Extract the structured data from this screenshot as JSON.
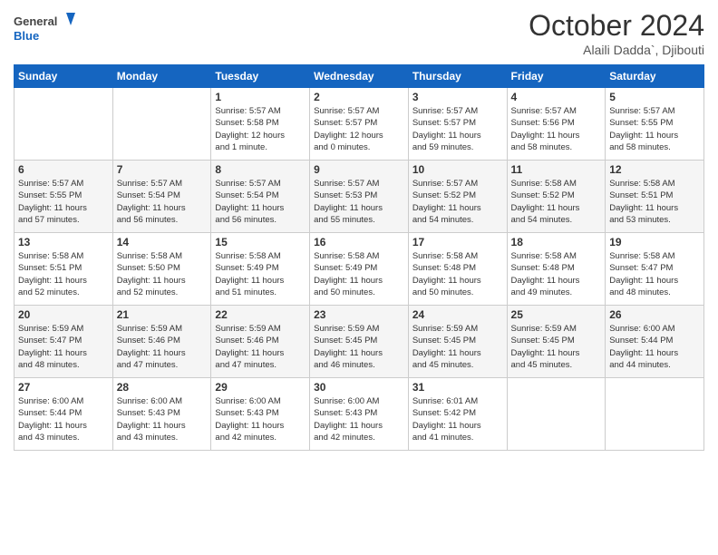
{
  "header": {
    "logo_line1": "General",
    "logo_line2": "Blue",
    "month": "October 2024",
    "location": "Alaili Dadda`, Djibouti"
  },
  "weekdays": [
    "Sunday",
    "Monday",
    "Tuesday",
    "Wednesday",
    "Thursday",
    "Friday",
    "Saturday"
  ],
  "weeks": [
    [
      {
        "day": "",
        "info": ""
      },
      {
        "day": "",
        "info": ""
      },
      {
        "day": "1",
        "info": "Sunrise: 5:57 AM\nSunset: 5:58 PM\nDaylight: 12 hours\nand 1 minute."
      },
      {
        "day": "2",
        "info": "Sunrise: 5:57 AM\nSunset: 5:57 PM\nDaylight: 12 hours\nand 0 minutes."
      },
      {
        "day": "3",
        "info": "Sunrise: 5:57 AM\nSunset: 5:57 PM\nDaylight: 11 hours\nand 59 minutes."
      },
      {
        "day": "4",
        "info": "Sunrise: 5:57 AM\nSunset: 5:56 PM\nDaylight: 11 hours\nand 58 minutes."
      },
      {
        "day": "5",
        "info": "Sunrise: 5:57 AM\nSunset: 5:55 PM\nDaylight: 11 hours\nand 58 minutes."
      }
    ],
    [
      {
        "day": "6",
        "info": "Sunrise: 5:57 AM\nSunset: 5:55 PM\nDaylight: 11 hours\nand 57 minutes."
      },
      {
        "day": "7",
        "info": "Sunrise: 5:57 AM\nSunset: 5:54 PM\nDaylight: 11 hours\nand 56 minutes."
      },
      {
        "day": "8",
        "info": "Sunrise: 5:57 AM\nSunset: 5:54 PM\nDaylight: 11 hours\nand 56 minutes."
      },
      {
        "day": "9",
        "info": "Sunrise: 5:57 AM\nSunset: 5:53 PM\nDaylight: 11 hours\nand 55 minutes."
      },
      {
        "day": "10",
        "info": "Sunrise: 5:57 AM\nSunset: 5:52 PM\nDaylight: 11 hours\nand 54 minutes."
      },
      {
        "day": "11",
        "info": "Sunrise: 5:58 AM\nSunset: 5:52 PM\nDaylight: 11 hours\nand 54 minutes."
      },
      {
        "day": "12",
        "info": "Sunrise: 5:58 AM\nSunset: 5:51 PM\nDaylight: 11 hours\nand 53 minutes."
      }
    ],
    [
      {
        "day": "13",
        "info": "Sunrise: 5:58 AM\nSunset: 5:51 PM\nDaylight: 11 hours\nand 52 minutes."
      },
      {
        "day": "14",
        "info": "Sunrise: 5:58 AM\nSunset: 5:50 PM\nDaylight: 11 hours\nand 52 minutes."
      },
      {
        "day": "15",
        "info": "Sunrise: 5:58 AM\nSunset: 5:49 PM\nDaylight: 11 hours\nand 51 minutes."
      },
      {
        "day": "16",
        "info": "Sunrise: 5:58 AM\nSunset: 5:49 PM\nDaylight: 11 hours\nand 50 minutes."
      },
      {
        "day": "17",
        "info": "Sunrise: 5:58 AM\nSunset: 5:48 PM\nDaylight: 11 hours\nand 50 minutes."
      },
      {
        "day": "18",
        "info": "Sunrise: 5:58 AM\nSunset: 5:48 PM\nDaylight: 11 hours\nand 49 minutes."
      },
      {
        "day": "19",
        "info": "Sunrise: 5:58 AM\nSunset: 5:47 PM\nDaylight: 11 hours\nand 48 minutes."
      }
    ],
    [
      {
        "day": "20",
        "info": "Sunrise: 5:59 AM\nSunset: 5:47 PM\nDaylight: 11 hours\nand 48 minutes."
      },
      {
        "day": "21",
        "info": "Sunrise: 5:59 AM\nSunset: 5:46 PM\nDaylight: 11 hours\nand 47 minutes."
      },
      {
        "day": "22",
        "info": "Sunrise: 5:59 AM\nSunset: 5:46 PM\nDaylight: 11 hours\nand 47 minutes."
      },
      {
        "day": "23",
        "info": "Sunrise: 5:59 AM\nSunset: 5:45 PM\nDaylight: 11 hours\nand 46 minutes."
      },
      {
        "day": "24",
        "info": "Sunrise: 5:59 AM\nSunset: 5:45 PM\nDaylight: 11 hours\nand 45 minutes."
      },
      {
        "day": "25",
        "info": "Sunrise: 5:59 AM\nSunset: 5:45 PM\nDaylight: 11 hours\nand 45 minutes."
      },
      {
        "day": "26",
        "info": "Sunrise: 6:00 AM\nSunset: 5:44 PM\nDaylight: 11 hours\nand 44 minutes."
      }
    ],
    [
      {
        "day": "27",
        "info": "Sunrise: 6:00 AM\nSunset: 5:44 PM\nDaylight: 11 hours\nand 43 minutes."
      },
      {
        "day": "28",
        "info": "Sunrise: 6:00 AM\nSunset: 5:43 PM\nDaylight: 11 hours\nand 43 minutes."
      },
      {
        "day": "29",
        "info": "Sunrise: 6:00 AM\nSunset: 5:43 PM\nDaylight: 11 hours\nand 42 minutes."
      },
      {
        "day": "30",
        "info": "Sunrise: 6:00 AM\nSunset: 5:43 PM\nDaylight: 11 hours\nand 42 minutes."
      },
      {
        "day": "31",
        "info": "Sunrise: 6:01 AM\nSunset: 5:42 PM\nDaylight: 11 hours\nand 41 minutes."
      },
      {
        "day": "",
        "info": ""
      },
      {
        "day": "",
        "info": ""
      }
    ]
  ]
}
